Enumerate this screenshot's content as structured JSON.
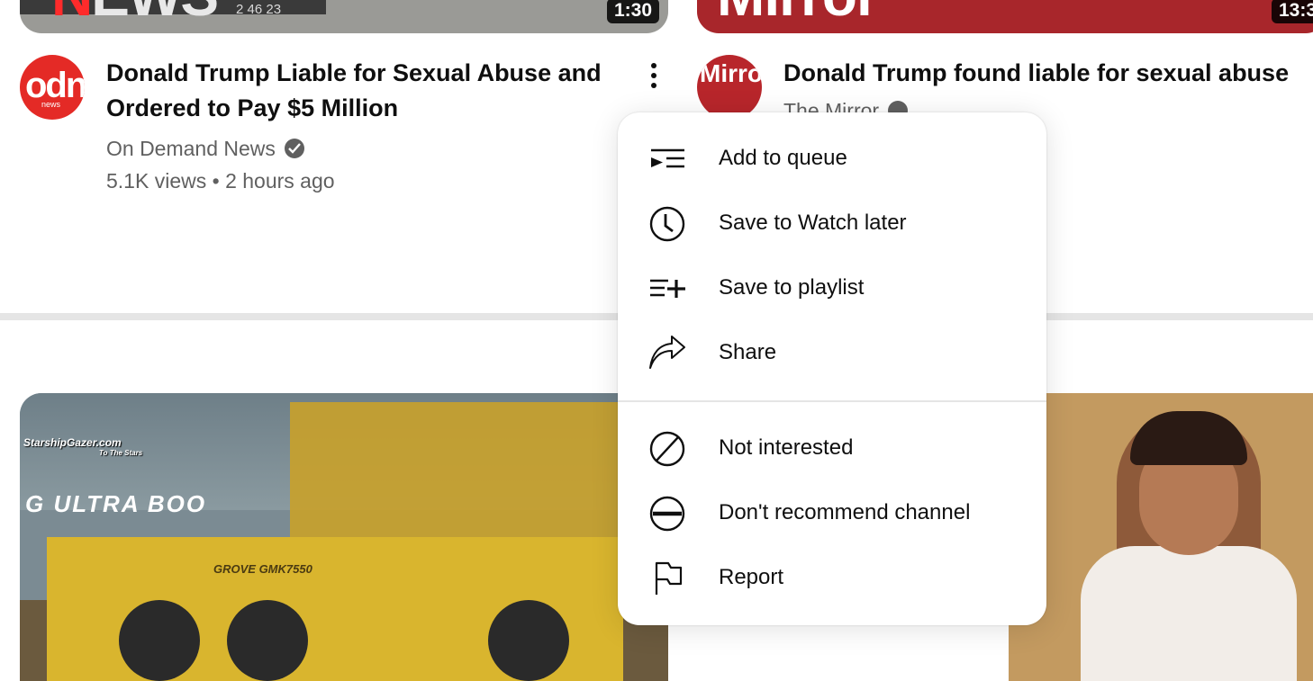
{
  "feed": {
    "top_left_video": {
      "thumbnail_text": "NEWS",
      "thumbnail_timestamp": "2 46 23",
      "duration": "1:30",
      "title": "Donald Trump Liable for Sexual Abuse and Ordered to Pay $5 Million",
      "title_line1": "Donald Trump Liable for Sexual Abuse and",
      "title_line2": "Ordered to Pay $5 Million",
      "channel": "On Demand News",
      "channel_avatar_text": "odn",
      "channel_avatar_subtext": "news",
      "views": "5.1K views",
      "age": "2 hours ago",
      "verified": true
    },
    "top_right_video": {
      "thumbnail_text": "Mirror",
      "duration": "13:3",
      "title": "Donald Trump found liable for sexual abuse",
      "channel": "The Mirror",
      "channel_avatar_text": "Mirror",
      "verified": true
    },
    "bottom_left_video": {
      "watermark": "StarshipGazer.com",
      "watermark_sub": "To The Stars",
      "overlay_text": "G ULTRA BOO",
      "truck_text": "GROVE GMK7550"
    },
    "bottom_right_video": {}
  },
  "menu": {
    "items": [
      {
        "label": "Add to queue",
        "icon": "add-to-queue-icon"
      },
      {
        "label": "Save to Watch later",
        "icon": "clock-icon"
      },
      {
        "label": "Save to playlist",
        "icon": "playlist-add-icon"
      },
      {
        "label": "Share",
        "icon": "share-icon"
      },
      {
        "label": "Not interested",
        "icon": "block-icon"
      },
      {
        "label": "Don't recommend channel",
        "icon": "minus-circle-icon"
      },
      {
        "label": "Report",
        "icon": "flag-icon"
      }
    ]
  },
  "colors": {
    "text_primary": "#0f0f0f",
    "text_secondary": "#606060",
    "menu_bg": "#ffffff",
    "odn_red": "#e42a26",
    "mirror_red": "#b8262b"
  }
}
